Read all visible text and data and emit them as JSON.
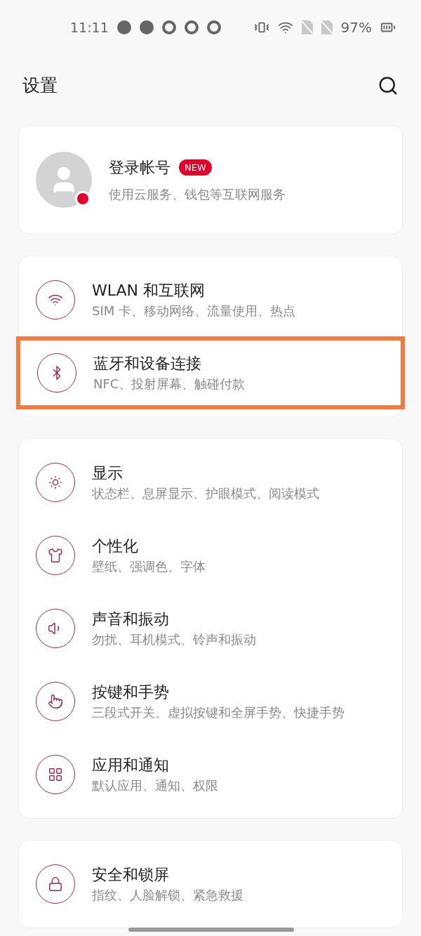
{
  "status_bar": {
    "time": "11:11",
    "battery": "97%"
  },
  "header": {
    "title": "设置"
  },
  "account": {
    "title": "登录帐号",
    "badge": "NEW",
    "subtitle": "使用云服务、钱包等互联网服务",
    "notification_dot": true
  },
  "groups": [
    {
      "items": [
        {
          "kind": "wifi",
          "title": "WLAN 和互联网",
          "subtitle": "SIM 卡、移动网络、流量使用、热点",
          "highlighted": false
        },
        {
          "kind": "bluetooth",
          "title": "蓝牙和设备连接",
          "subtitle": "NFC、投射屏幕、触碰付款",
          "highlighted": true
        }
      ]
    },
    {
      "items": [
        {
          "kind": "display",
          "title": "显示",
          "subtitle": "状态栏、息屏显示、护眼模式、阅读模式",
          "highlighted": false
        },
        {
          "kind": "personalize",
          "title": "个性化",
          "subtitle": "壁纸、强调色、字体",
          "highlighted": false
        },
        {
          "kind": "sound",
          "title": "声音和振动",
          "subtitle": "勿扰、耳机模式、铃声和振动",
          "highlighted": false
        },
        {
          "kind": "gesture",
          "title": "按键和手势",
          "subtitle": "三段式开关、虚拟按键和全屏手势、快捷手势",
          "highlighted": false
        },
        {
          "kind": "apps",
          "title": "应用和通知",
          "subtitle": "默认应用、通知、权限",
          "highlighted": false
        }
      ]
    },
    {
      "items": [
        {
          "kind": "security",
          "title": "安全和锁屏",
          "subtitle": "指纹、人脸解锁、紧急救援",
          "highlighted": false
        }
      ]
    }
  ]
}
